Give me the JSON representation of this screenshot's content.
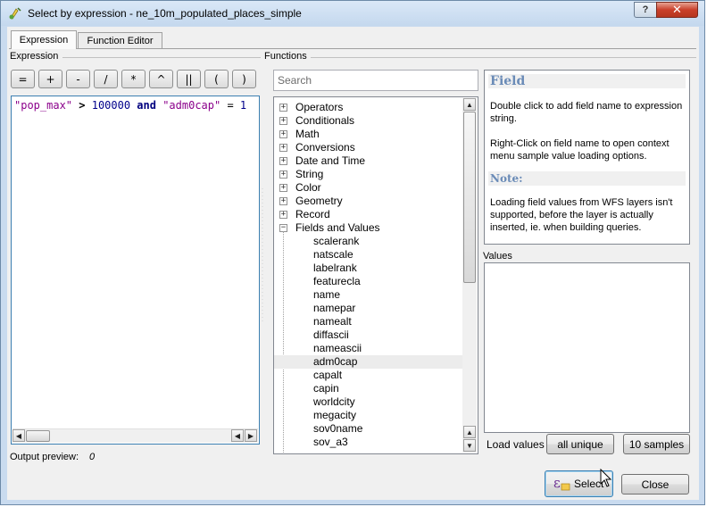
{
  "window": {
    "title": "Select by expression - ne_10m_populated_places_simple",
    "help_glyph": "?",
    "close_glyph": "✕"
  },
  "tabs": [
    {
      "label": "Expression",
      "active": true
    },
    {
      "label": "Function Editor",
      "active": false
    }
  ],
  "expression_section": {
    "label": "Expression",
    "operators": [
      "=",
      "+",
      "-",
      "/",
      "*",
      "^",
      "||",
      "(",
      ")"
    ],
    "expression_tokens": [
      {
        "text": "\"pop_max\"",
        "kind": "field"
      },
      {
        "text": " > ",
        "kind": "op"
      },
      {
        "text": "100000",
        "kind": "num"
      },
      {
        "text": " and ",
        "kind": "kw"
      },
      {
        "text": "\"adm0cap\"",
        "kind": "field"
      },
      {
        "text": " = ",
        "kind": "op"
      },
      {
        "text": "1",
        "kind": "num"
      }
    ],
    "output_preview_label": "Output preview:",
    "output_preview_value": "0"
  },
  "functions_section": {
    "label": "Functions",
    "search_placeholder": "Search",
    "groups": [
      "Operators",
      "Conditionals",
      "Math",
      "Conversions",
      "Date and Time",
      "String",
      "Color",
      "Geometry",
      "Record"
    ],
    "expanded_group": "Fields and Values",
    "fields": [
      "scalerank",
      "natscale",
      "labelrank",
      "featurecla",
      "name",
      "namepar",
      "namealt",
      "diffascii",
      "nameascii",
      "adm0cap",
      "capalt",
      "capin",
      "worldcity",
      "megacity",
      "sov0name",
      "sov_a3"
    ],
    "selected_field": "adm0cap"
  },
  "help_panel": {
    "heading": "Field",
    "paragraph1": "Double click to add field name to expression string.",
    "paragraph2": "Right-Click on field name to open context menu sample value loading options.",
    "note_heading": "Note:",
    "note_text": "Loading field values from WFS layers isn't supported, before the layer is actually inserted, ie. when building queries."
  },
  "values_section": {
    "label": "Values",
    "load_values_label": "Load values",
    "all_unique_label": "all unique",
    "samples_label": "10 samples"
  },
  "footer": {
    "select_label": "Select",
    "close_label": "Close"
  },
  "colors": {
    "field": "#8b008b",
    "number": "#00008b",
    "keyword": "#00007f",
    "help_heading": "#6a8bb7"
  }
}
